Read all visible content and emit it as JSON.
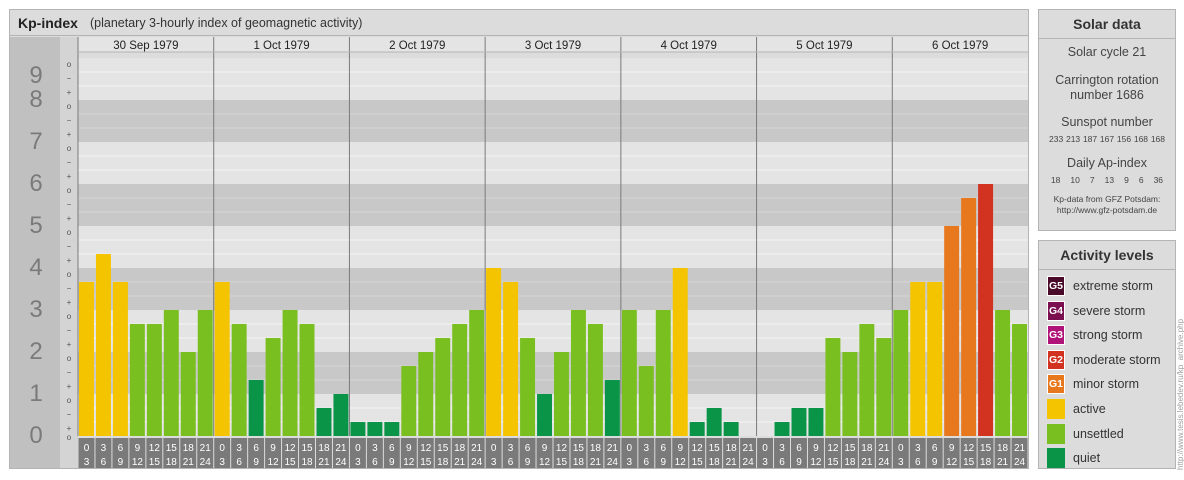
{
  "title": {
    "main": "Kp-index",
    "subtitle": "(planetary 3-hourly index of geomagnetic activity)"
  },
  "chart_data": {
    "type": "bar",
    "ylim": [
      0,
      9
    ],
    "y_ticks": [
      "0",
      "1",
      "2",
      "3",
      "4",
      "5",
      "6",
      "7",
      "8",
      "9"
    ],
    "sub_ticks": [
      "+",
      "o",
      "−"
    ],
    "days": [
      "30 Sep 1979",
      "1 Oct 1979",
      "2 Oct 1979",
      "3 Oct 1979",
      "4 Oct 1979",
      "5 Oct 1979",
      "6 Oct 1979"
    ],
    "interval_top": [
      "0",
      "3",
      "6",
      "9",
      "12",
      "15",
      "18",
      "21"
    ],
    "interval_bottom": [
      "3",
      "6",
      "9",
      "12",
      "15",
      "18",
      "21",
      "24"
    ],
    "values": [
      [
        3.667,
        4.333,
        3.667,
        2.667,
        2.667,
        3.0,
        2.0,
        3.0
      ],
      [
        3.667,
        2.667,
        1.333,
        2.333,
        3.0,
        2.667,
        0.667,
        1.0
      ],
      [
        0.333,
        0.333,
        0.333,
        1.667,
        2.0,
        2.333,
        2.667,
        3.0
      ],
      [
        4.0,
        3.667,
        2.333,
        1.0,
        2.0,
        3.0,
        2.667,
        1.333
      ],
      [
        3.0,
        1.667,
        3.0,
        4.0,
        0.333,
        0.667,
        0.333,
        0.0
      ],
      [
        0.0,
        0.333,
        0.667,
        0.667,
        2.333,
        2.0,
        2.667,
        2.333
      ],
      [
        3.0,
        3.667,
        3.667,
        5.0,
        5.667,
        6.0,
        3.0,
        2.667
      ]
    ]
  },
  "solar": {
    "heading": "Solar data",
    "cycle": "Solar cycle 21",
    "carrington_line1": "Carrington rotation",
    "carrington_line2": "number 1686",
    "sunspot_label": "Sunspot number",
    "sunspot_values": [
      "233",
      "213",
      "187",
      "167",
      "156",
      "168",
      "168"
    ],
    "ap_label": "Daily Ap-index",
    "ap_values": [
      "18",
      "10",
      "7",
      "13",
      "9",
      "6",
      "36"
    ],
    "credit_line1": "Kp-data from GFZ Potsdam:",
    "credit_line2": "http://www.gfz-potsdam.de"
  },
  "levels": {
    "heading": "Activity levels",
    "items": [
      {
        "badge": "G5",
        "label": "extreme storm",
        "color": "#4a0a2a"
      },
      {
        "badge": "G4",
        "label": "severe storm",
        "color": "#7a1050"
      },
      {
        "badge": "G3",
        "label": "strong storm",
        "color": "#b01478"
      },
      {
        "badge": "G2",
        "label": "moderate storm",
        "color": "#d23220"
      },
      {
        "badge": "G1",
        "label": "minor storm",
        "color": "#e8781e"
      },
      {
        "badge": "",
        "label": "active",
        "color": "#f5c400"
      },
      {
        "badge": "",
        "label": "unsettled",
        "color": "#7abf20"
      },
      {
        "badge": "",
        "label": "quiet",
        "color": "#0a9448"
      }
    ]
  },
  "colors": {
    "quiet": "#0a9448",
    "unsettled": "#7abf20",
    "active": "#f5c400",
    "minor_storm": "#e8781e",
    "moderate_storm": "#d23220"
  },
  "watermark": "http://www.tesis.lebedev.ru/kp_archive.php"
}
